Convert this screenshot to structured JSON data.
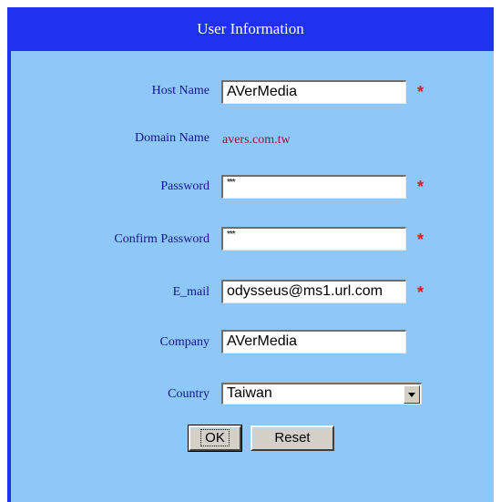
{
  "header": {
    "title": "User Information"
  },
  "form": {
    "host_name_label": "Host Name",
    "host_name_value": "AVerMedia",
    "domain_name_label": "Domain Name",
    "domain_name_value": "avers.com.tw",
    "password_label": "Password",
    "password_value": "***",
    "confirm_password_label": "Confirm Password",
    "confirm_password_value": "***",
    "email_label": "E_mail",
    "email_value": "odysseus@ms1.url.com",
    "company_label": "Company",
    "company_value": "AVerMedia",
    "country_label": "Country",
    "country_value": "Taiwan",
    "required_marker": "*"
  },
  "buttons": {
    "ok_label": "OK",
    "reset_label": "Reset"
  },
  "colors": {
    "header_bg": "#1e32f0",
    "panel_bg": "#8ec8f8",
    "label_text": "#14148c",
    "domain_value_text": "#8b1a3a",
    "required_marker": "#e01818"
  }
}
